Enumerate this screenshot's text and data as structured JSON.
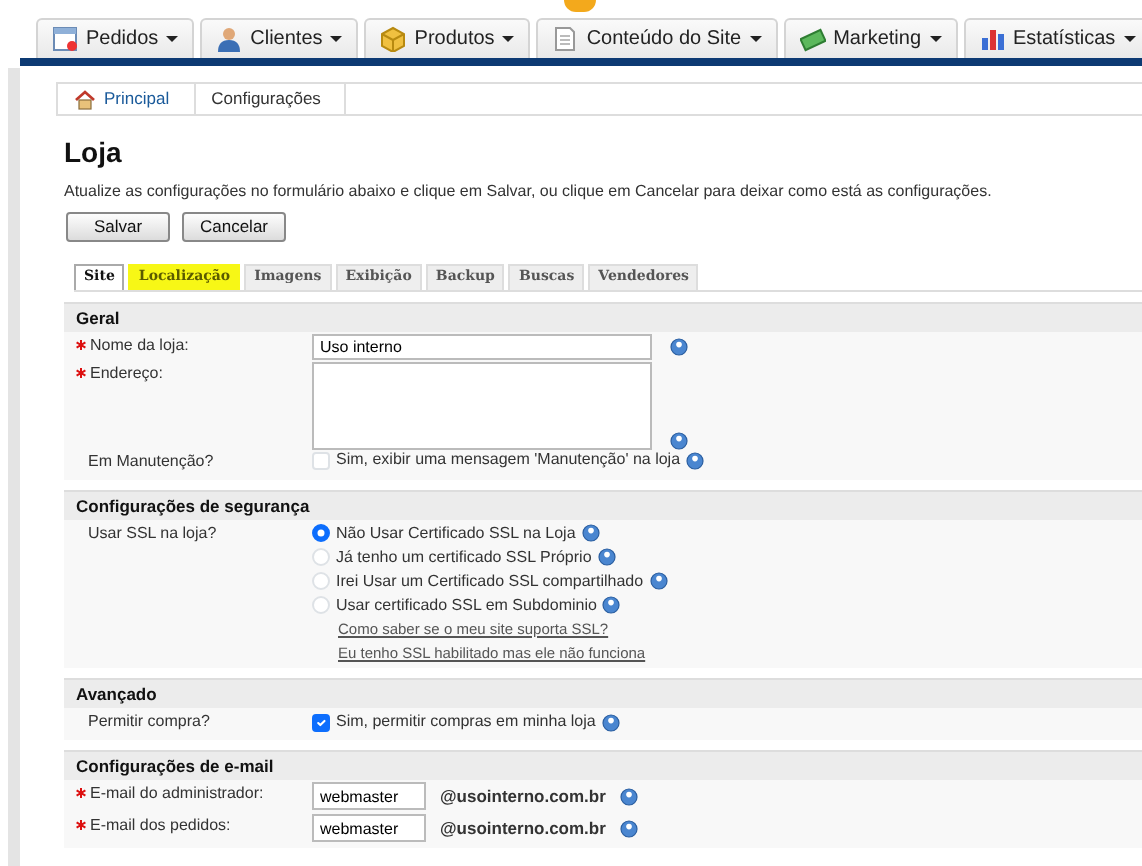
{
  "top_menu": [
    {
      "label": "Pedidos",
      "selected": false
    },
    {
      "label": "Clientes",
      "selected": false
    },
    {
      "label": "Produtos",
      "selected": false
    },
    {
      "label": "Conteúdo do Site",
      "selected": false
    },
    {
      "label": "Marketing",
      "selected": false
    },
    {
      "label": "Estatísticas",
      "selected": false
    }
  ],
  "breadcrumb": [
    "Principal",
    "Configurações"
  ],
  "title": "Loja",
  "description": "Atualize as configurações no formulário abaixo e clique em Salvar, ou clique em Cancelar para deixar como está as configurações.",
  "buttons": [
    "Salvar",
    "Cancelar"
  ],
  "tabs": [
    {
      "label": "Site",
      "selected": true,
      "highlighted": false
    },
    {
      "label": "Localização",
      "selected": false,
      "highlighted": true
    },
    {
      "label": "Imagens",
      "selected": false,
      "highlighted": false
    },
    {
      "label": "Exibição",
      "selected": false,
      "highlighted": false
    },
    {
      "label": "Backup",
      "selected": false,
      "highlighted": false
    },
    {
      "label": "Buscas",
      "selected": false,
      "highlighted": false
    },
    {
      "label": "Vendedores",
      "selected": false,
      "highlighted": false
    }
  ],
  "sections": [
    {
      "title": "Geral",
      "rows": [
        {
          "kind": "text",
          "label": "Nome da loja:",
          "required": true,
          "value": "Uso interno"
        },
        {
          "kind": "textarea",
          "label": "Endereço:",
          "required": true
        },
        {
          "kind": "checkbox",
          "label": "Em Manutenção?",
          "required": false,
          "checked": false,
          "text": "Sim, exibir uma mensagem 'Manutenção' na loja"
        }
      ]
    },
    {
      "title": "Configurações de segurança",
      "rows": [
        {
          "kind": "radio",
          "label": "Usar SSL na loja?",
          "required": false,
          "options": [
            {
              "label": "Não Usar Certificado SSL na Loja",
              "selected": true
            },
            {
              "label": "Já tenho um certificado SSL Próprio",
              "selected": false
            },
            {
              "label": "Irei Usar um Certificado SSL compartilhado",
              "selected": false
            },
            {
              "label": "Usar certificado SSL em Subdominio",
              "selected": false
            }
          ],
          "links": [
            "Como saber se o meu site suporta SSL?",
            "Eu tenho SSL habilitado mas ele não funciona"
          ]
        }
      ]
    },
    {
      "title": "Avançado",
      "rows": [
        {
          "kind": "checkbox",
          "label": "Permitir compra?",
          "required": false,
          "checked": true,
          "text": "Sim, permitir compras em minha loja"
        }
      ]
    },
    {
      "title": "Configurações de e-mail",
      "rows": [
        {
          "kind": "email",
          "label": "E-mail do administrador:",
          "required": true,
          "value": "webmaster",
          "suffix": "@usointerno.com.br"
        },
        {
          "kind": "email",
          "label": "E-mail dos pedidos:",
          "required": true,
          "value": "webmaster",
          "suffix": "@usointerno.com.br"
        }
      ]
    }
  ]
}
